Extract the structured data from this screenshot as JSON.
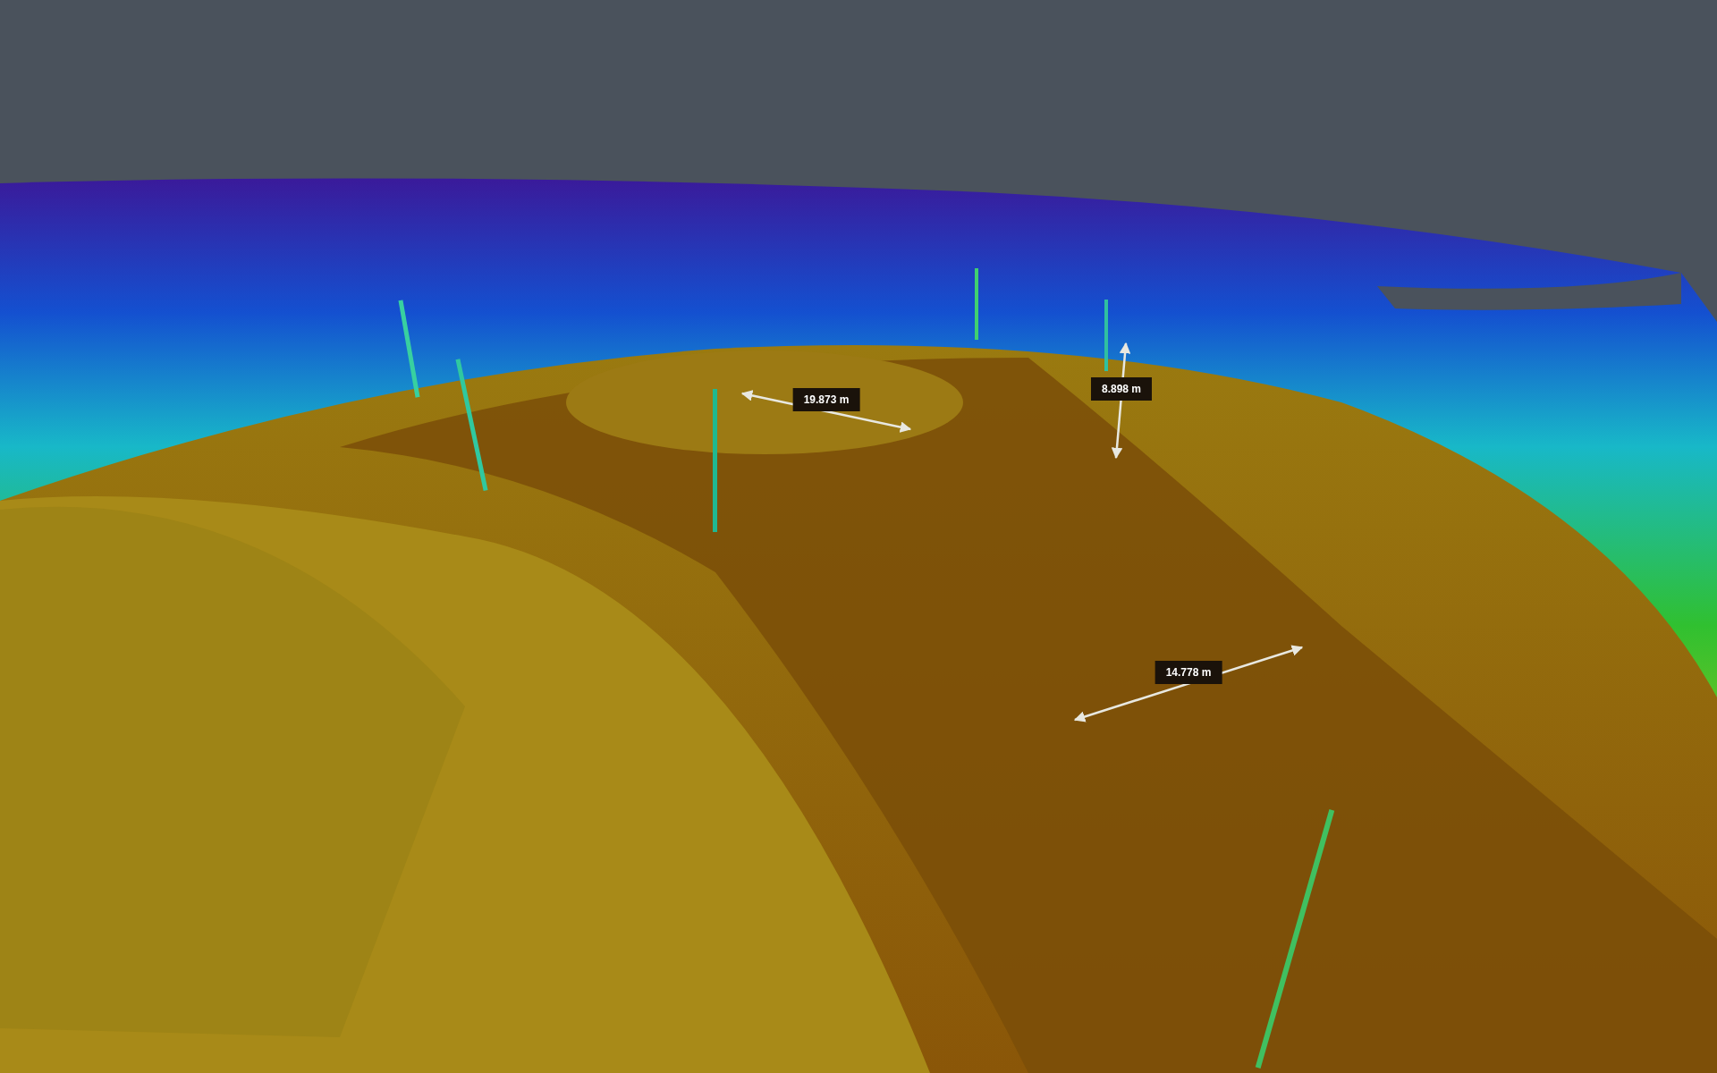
{
  "measurements": [
    {
      "label": "19.873 m"
    },
    {
      "label": "8.898 m"
    },
    {
      "label": "14.778 m"
    }
  ]
}
